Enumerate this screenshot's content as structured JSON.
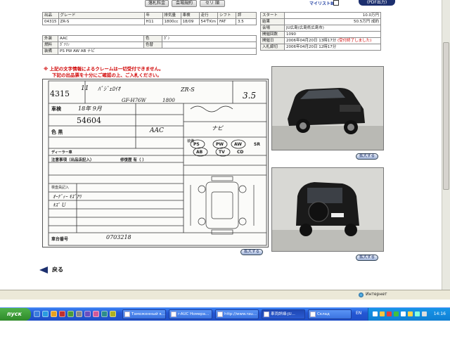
{
  "toolbar": {
    "buttons": [
      "落札料金",
      "会場規約",
      "セリ 順"
    ],
    "mylist": "マイリストB",
    "corner": "(PDF出力)"
  },
  "spec_table": {
    "headers": [
      "出品",
      "グレード",
      "年",
      "排気量",
      "車検",
      "走行",
      "シフト",
      "評"
    ],
    "values": [
      "04315",
      "ZR-S",
      "H11",
      "1800cc",
      "18/09",
      "54千Km",
      "FAT",
      "3.5"
    ]
  },
  "color_table": {
    "rows": [
      {
        "label": "外装",
        "value": "AAC",
        "label2": "色",
        "value2": "ｶﾞﾝ"
      },
      {
        "label": "燃料",
        "value": "ｶﾞｿﾘﾝ",
        "label2": "色替",
        "value2": ""
      },
      {
        "label": "装備",
        "value": "PS PW AW AB ナビ",
        "label2": "",
        "value2": ""
      }
    ]
  },
  "price_table": {
    "rows": [
      {
        "label": "スタート",
        "value": "10.0万円"
      },
      {
        "label": "結果",
        "value": "50.5万円 成約"
      },
      {
        "label": "会場",
        "value": "JU広島(広島県広島市)"
      },
      {
        "label": "開催回数",
        "value": "1090"
      },
      {
        "label": "開催日",
        "value": "2006年04月20日 13時17分",
        "note": "(受付終了しました)"
      },
      {
        "label": "入札締切",
        "value": "2006年04月20日 12時17分"
      }
    ]
  },
  "warning": {
    "line1": "※ 上記の文字情報によるクレームは一切受付できません。",
    "line2": "下記の出品票を十分にご確認の上、ご入札ください。"
  },
  "sheet": {
    "lot": "4315",
    "year": "11",
    "name": "ﾊﾟｼﾞｪﾛｲｵ",
    "grade": "ZR-S",
    "score": "3.5",
    "model": "GF-H76W",
    "cc": "1800",
    "label_inspection": "車検",
    "inspection": "18年 9月",
    "mileage": "54604",
    "label_color": "色 黒",
    "color_code": "AAC",
    "nav": "ナビ",
    "label_dealer": "ディーラー車",
    "label_notes": "注意事項（出品店記入）",
    "label_history": "修復歴 有（ ）",
    "label_inspector": "検査員記入",
    "label_equip": "装備",
    "equip": [
      "PS",
      "PW",
      "AW",
      "SR",
      "AB",
      "TV",
      "CD"
    ],
    "note_hand": "ｵｰﾃﾞｨｰ ｷｽﾞｱﾘ",
    "note_hand2": "ｷｽﾞ U",
    "label_chassis": "車台番号",
    "chassis": "0703218"
  },
  "zoom_labels": [
    "拡大する",
    "拡大する",
    "拡大する"
  ],
  "back_label": "戻る",
  "status": {
    "zone": "Интернет"
  },
  "taskbar": {
    "start": "пуск",
    "tasks": [
      "Таможенный к...",
      "r-AUC Номера...",
      "http://www.rau...",
      "車両詳細-JU...",
      "Склад"
    ],
    "lang": "EN",
    "clock": "14:16"
  }
}
